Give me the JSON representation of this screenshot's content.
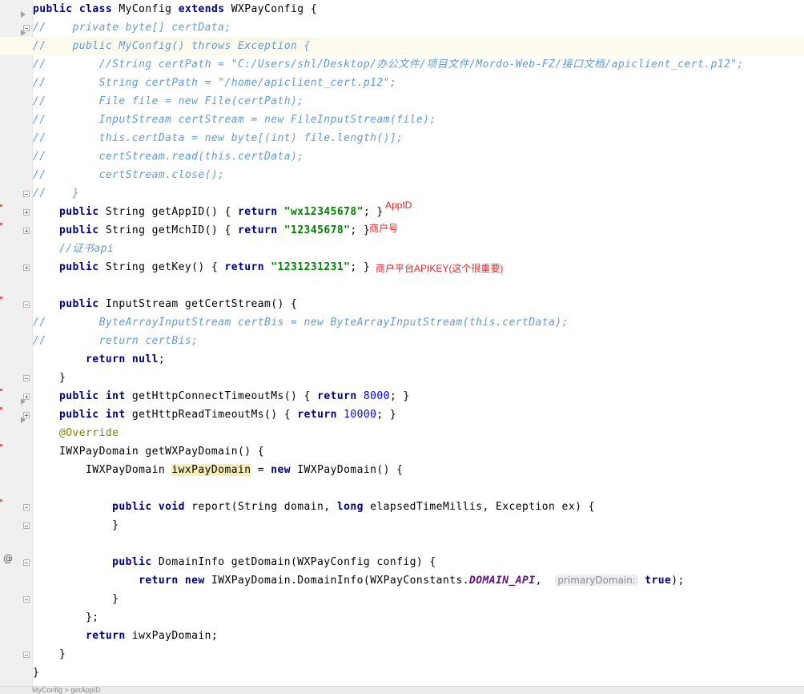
{
  "editor": {
    "lines": [
      [
        "public class MyConfig extends WXPayConfig {"
      ],
      [
        "//    private byte[] certData;"
      ],
      [
        "//    public MyConfig() throws Exception {"
      ],
      [
        "//        //String certPath = \"C:/Users/shl/Desktop/办公文件/项目文件/Mordo-Web-FZ/接口文档/apiclient_cert.p12\";"
      ],
      [
        "//        String certPath = \"/home/apiclient_cert.p12\";"
      ],
      [
        "//        File file = new File(certPath);"
      ],
      [
        "//        InputStream certStream = new FileInputStream(file);"
      ],
      [
        "//        this.certData = new byte[(int) file.length()];"
      ],
      [
        "//        certStream.read(this.certData);"
      ],
      [
        "//        certStream.close();"
      ],
      [
        "//    }"
      ],
      [
        "    public",
        " String getAppID() { ",
        "return",
        " ",
        "\"wx12345678\"",
        "; }"
      ],
      [
        "    public",
        " String getMchID() { ",
        "return",
        " ",
        "\"12345678\"",
        "; }"
      ],
      [
        "    //证书api"
      ],
      [
        "    public",
        " String getKey() { ",
        "return",
        " ",
        "\"1231231231\"",
        "; }"
      ],
      [
        ""
      ],
      [
        "    public",
        " InputStream getCertStream() {"
      ],
      [
        "//        ByteArrayInputStream certBis = new ByteArrayInputStream(this.certData);"
      ],
      [
        "//        return certBis;"
      ],
      [
        "        return",
        " ",
        "null",
        ";"
      ],
      [
        "    }"
      ],
      [
        "    public",
        " ",
        "int",
        " getHttpConnectTimeoutMs() { ",
        "return",
        " ",
        "8000",
        "; }"
      ],
      [
        "    public",
        " ",
        "int",
        " getHttpReadTimeoutMs() { ",
        "return",
        " ",
        "10000",
        "; }"
      ],
      [
        "    @Override"
      ],
      [
        "    IWXPayDomain getWXPayDomain() {"
      ],
      [
        "        IWXPayDomain ",
        "iwxPayDomain",
        " = ",
        "new",
        " IWXPayDomain() {"
      ],
      [
        ""
      ],
      [
        "            public",
        " ",
        "void",
        " report(String domain, ",
        "long",
        " elapsedTimeMillis, Exception ex) {"
      ],
      [
        "            }"
      ],
      [
        ""
      ],
      [
        "            public",
        " DomainInfo getDomain(WXPayConfig config) {"
      ],
      [
        "                return",
        " ",
        "new",
        " IWXPayDomain.DomainInfo(WXPayConstants.",
        "DOMAIN_API",
        ",  ",
        "primaryDomain:",
        " ",
        "true",
        ");"
      ],
      [
        "            }"
      ],
      [
        "        };"
      ],
      [
        "        return",
        " iwxPayDomain;"
      ],
      [
        "    }"
      ],
      [
        "}"
      ]
    ],
    "notes": {
      "appid": "AppID",
      "mchid": "商户号",
      "apikey": "商户平台APIKEY(这个很重要)"
    },
    "gutter_marker": "@",
    "bottom_text": "MyConfig > getAppID"
  }
}
